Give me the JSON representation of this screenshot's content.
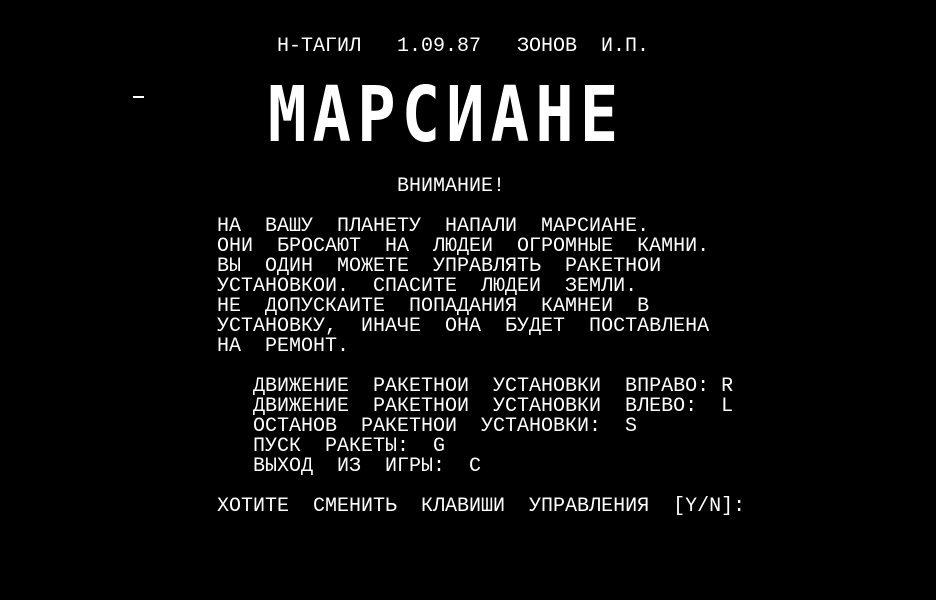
{
  "header": {
    "line": "Н-ТАГИЛ   1.09.87   ЗОНОВ  И.П."
  },
  "title": "МАРСИАНЕ",
  "warning": "ВНИМАНИЕ!",
  "story": [
    "НА  ВАШУ  ПЛАНЕТУ  НАПАЛИ  МАРСИАНЕ.",
    "ОНИ  БРОСАЮТ  НА  ЛЮДЕИ  ОГРОМНЫЕ  КАМНИ.",
    "ВЫ  ОДИН  МОЖЕТЕ  УПРАВЛЯТЬ  РАКЕТНОИ",
    "УСТАНОВКОИ.  СПАСИТЕ  ЛЮДЕИ  ЗЕМЛИ.",
    "НЕ  ДОПУСКАИТЕ  ПОПАДАНИЯ  КАМНЕИ  В",
    "УСТАНОВКУ,  ИНАЧЕ  ОНА  БУДЕТ  ПОСТАВЛЕНА",
    "НА  РЕМОНТ."
  ],
  "controls": [
    "ДВИЖЕНИЕ  РАКЕТНОИ  УСТАНОВКИ  ВПРАВО: R",
    "ДВИЖЕНИЕ  РАКЕТНОИ  УСТАНОВКИ  ВЛЕВО:  L",
    "ОСТАНОВ  РАКЕТНОИ  УСТАНОВКИ:  S",
    "ПУСК  РАКЕТЫ:  G",
    "ВЫХОД  ИЗ  ИГРЫ:  C"
  ],
  "prompt": "ХОТИТЕ  СМЕНИТЬ  КЛАВИШИ  УПРАВЛЕНИЯ  [Y/N]:",
  "colors": {
    "background": "#000000",
    "text": "#ffffff"
  }
}
